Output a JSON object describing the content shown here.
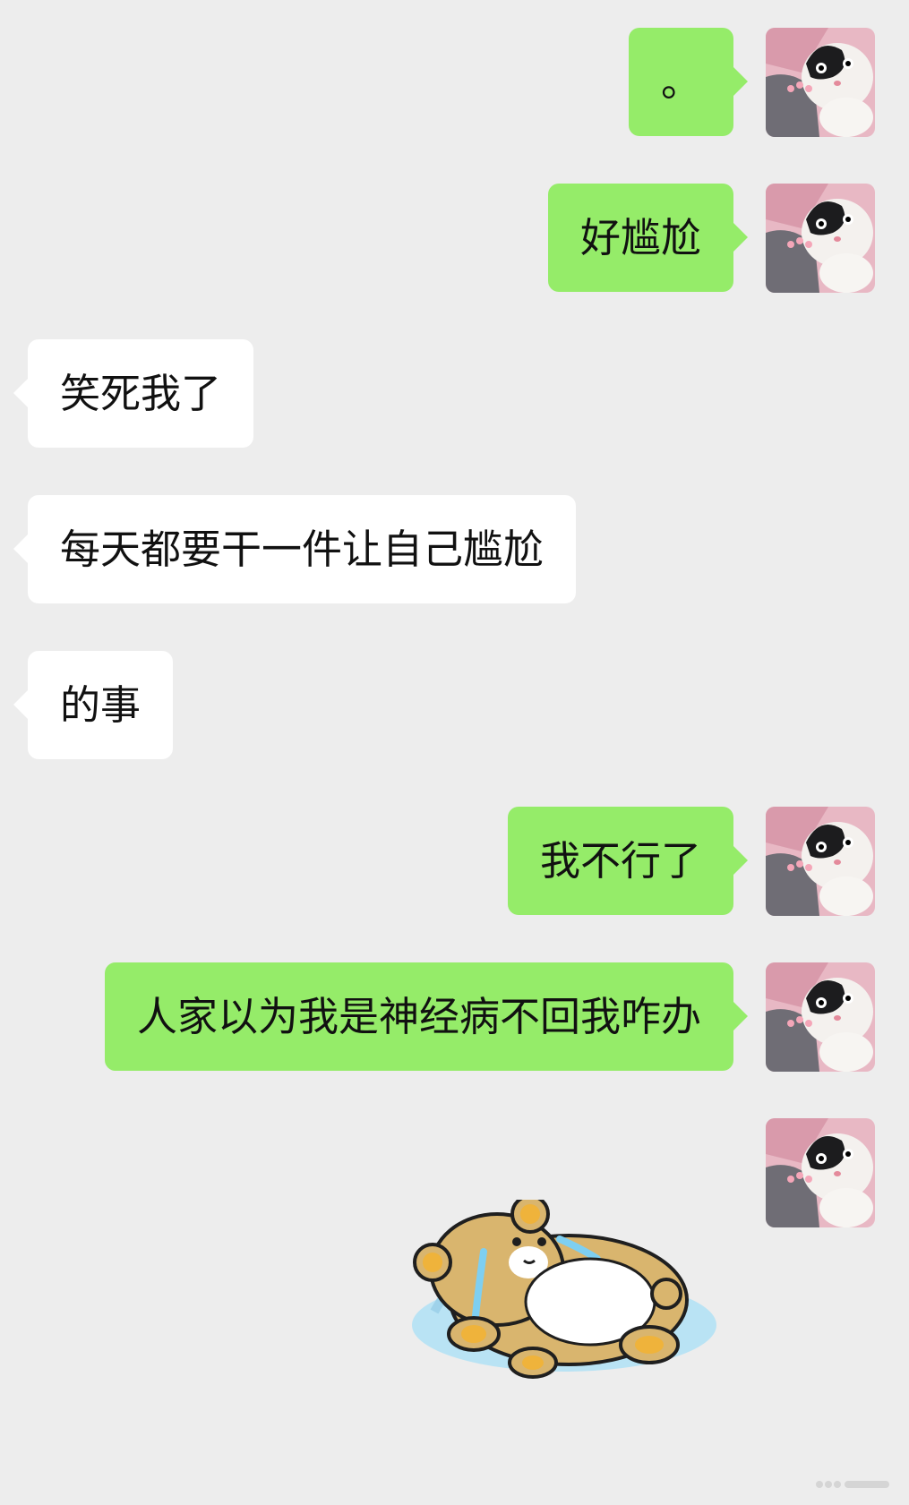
{
  "chat": {
    "messages": [
      {
        "sender": "me",
        "text": "。"
      },
      {
        "sender": "me",
        "text": "好尴尬"
      },
      {
        "sender": "other",
        "text": "笑死我了"
      },
      {
        "sender": "other",
        "text": "每天都要干一件让自己尴尬"
      },
      {
        "sender": "other",
        "text": "的事"
      },
      {
        "sender": "me",
        "text": "我不行了"
      },
      {
        "sender": "me",
        "text": "人家以为我是神经病不回我咋办"
      },
      {
        "sender": "me",
        "sticker": "crying-bear-sticker"
      }
    ]
  },
  "colors": {
    "background": "#ededed",
    "outgoing_bubble": "#95ec69",
    "incoming_bubble": "#ffffff",
    "text": "#111111"
  },
  "icons": {
    "avatar": "cat-avatar",
    "sticker": "crying-bear-sticker"
  }
}
